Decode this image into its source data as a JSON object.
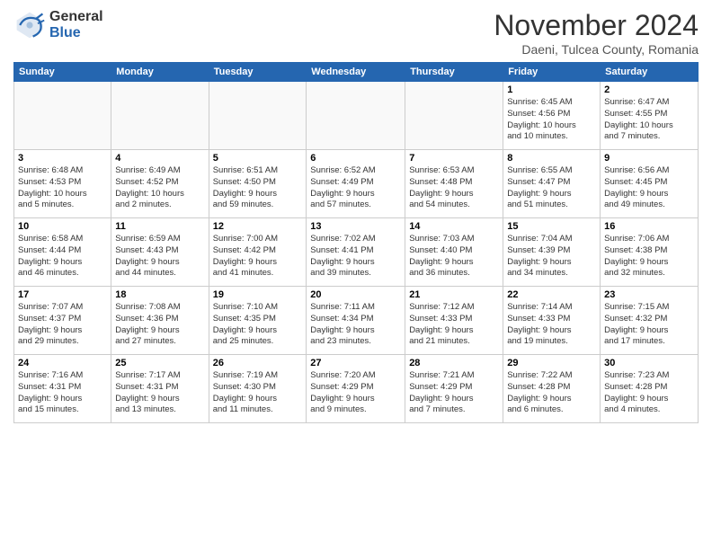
{
  "header": {
    "logo_general": "General",
    "logo_blue": "Blue",
    "month_title": "November 2024",
    "location": "Daeni, Tulcea County, Romania"
  },
  "weekdays": [
    "Sunday",
    "Monday",
    "Tuesday",
    "Wednesday",
    "Thursday",
    "Friday",
    "Saturday"
  ],
  "weeks": [
    [
      {
        "day": "",
        "info": "",
        "empty": true
      },
      {
        "day": "",
        "info": "",
        "empty": true
      },
      {
        "day": "",
        "info": "",
        "empty": true
      },
      {
        "day": "",
        "info": "",
        "empty": true
      },
      {
        "day": "",
        "info": "",
        "empty": true
      },
      {
        "day": "1",
        "info": "Sunrise: 6:45 AM\nSunset: 4:56 PM\nDaylight: 10 hours\nand 10 minutes."
      },
      {
        "day": "2",
        "info": "Sunrise: 6:47 AM\nSunset: 4:55 PM\nDaylight: 10 hours\nand 7 minutes."
      }
    ],
    [
      {
        "day": "3",
        "info": "Sunrise: 6:48 AM\nSunset: 4:53 PM\nDaylight: 10 hours\nand 5 minutes."
      },
      {
        "day": "4",
        "info": "Sunrise: 6:49 AM\nSunset: 4:52 PM\nDaylight: 10 hours\nand 2 minutes."
      },
      {
        "day": "5",
        "info": "Sunrise: 6:51 AM\nSunset: 4:50 PM\nDaylight: 9 hours\nand 59 minutes."
      },
      {
        "day": "6",
        "info": "Sunrise: 6:52 AM\nSunset: 4:49 PM\nDaylight: 9 hours\nand 57 minutes."
      },
      {
        "day": "7",
        "info": "Sunrise: 6:53 AM\nSunset: 4:48 PM\nDaylight: 9 hours\nand 54 minutes."
      },
      {
        "day": "8",
        "info": "Sunrise: 6:55 AM\nSunset: 4:47 PM\nDaylight: 9 hours\nand 51 minutes."
      },
      {
        "day": "9",
        "info": "Sunrise: 6:56 AM\nSunset: 4:45 PM\nDaylight: 9 hours\nand 49 minutes."
      }
    ],
    [
      {
        "day": "10",
        "info": "Sunrise: 6:58 AM\nSunset: 4:44 PM\nDaylight: 9 hours\nand 46 minutes."
      },
      {
        "day": "11",
        "info": "Sunrise: 6:59 AM\nSunset: 4:43 PM\nDaylight: 9 hours\nand 44 minutes."
      },
      {
        "day": "12",
        "info": "Sunrise: 7:00 AM\nSunset: 4:42 PM\nDaylight: 9 hours\nand 41 minutes."
      },
      {
        "day": "13",
        "info": "Sunrise: 7:02 AM\nSunset: 4:41 PM\nDaylight: 9 hours\nand 39 minutes."
      },
      {
        "day": "14",
        "info": "Sunrise: 7:03 AM\nSunset: 4:40 PM\nDaylight: 9 hours\nand 36 minutes."
      },
      {
        "day": "15",
        "info": "Sunrise: 7:04 AM\nSunset: 4:39 PM\nDaylight: 9 hours\nand 34 minutes."
      },
      {
        "day": "16",
        "info": "Sunrise: 7:06 AM\nSunset: 4:38 PM\nDaylight: 9 hours\nand 32 minutes."
      }
    ],
    [
      {
        "day": "17",
        "info": "Sunrise: 7:07 AM\nSunset: 4:37 PM\nDaylight: 9 hours\nand 29 minutes."
      },
      {
        "day": "18",
        "info": "Sunrise: 7:08 AM\nSunset: 4:36 PM\nDaylight: 9 hours\nand 27 minutes."
      },
      {
        "day": "19",
        "info": "Sunrise: 7:10 AM\nSunset: 4:35 PM\nDaylight: 9 hours\nand 25 minutes."
      },
      {
        "day": "20",
        "info": "Sunrise: 7:11 AM\nSunset: 4:34 PM\nDaylight: 9 hours\nand 23 minutes."
      },
      {
        "day": "21",
        "info": "Sunrise: 7:12 AM\nSunset: 4:33 PM\nDaylight: 9 hours\nand 21 minutes."
      },
      {
        "day": "22",
        "info": "Sunrise: 7:14 AM\nSunset: 4:33 PM\nDaylight: 9 hours\nand 19 minutes."
      },
      {
        "day": "23",
        "info": "Sunrise: 7:15 AM\nSunset: 4:32 PM\nDaylight: 9 hours\nand 17 minutes."
      }
    ],
    [
      {
        "day": "24",
        "info": "Sunrise: 7:16 AM\nSunset: 4:31 PM\nDaylight: 9 hours\nand 15 minutes."
      },
      {
        "day": "25",
        "info": "Sunrise: 7:17 AM\nSunset: 4:31 PM\nDaylight: 9 hours\nand 13 minutes."
      },
      {
        "day": "26",
        "info": "Sunrise: 7:19 AM\nSunset: 4:30 PM\nDaylight: 9 hours\nand 11 minutes."
      },
      {
        "day": "27",
        "info": "Sunrise: 7:20 AM\nSunset: 4:29 PM\nDaylight: 9 hours\nand 9 minutes."
      },
      {
        "day": "28",
        "info": "Sunrise: 7:21 AM\nSunset: 4:29 PM\nDaylight: 9 hours\nand 7 minutes."
      },
      {
        "day": "29",
        "info": "Sunrise: 7:22 AM\nSunset: 4:28 PM\nDaylight: 9 hours\nand 6 minutes."
      },
      {
        "day": "30",
        "info": "Sunrise: 7:23 AM\nSunset: 4:28 PM\nDaylight: 9 hours\nand 4 minutes."
      }
    ]
  ]
}
